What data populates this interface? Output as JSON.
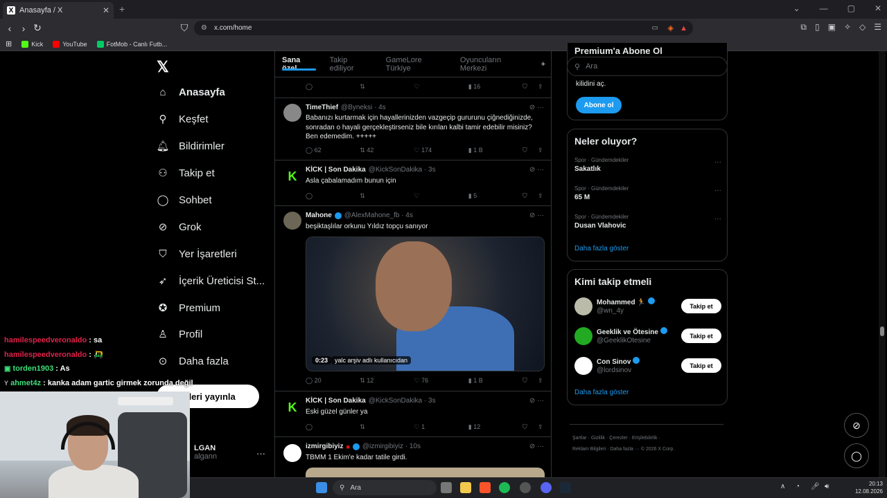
{
  "browser": {
    "tab_title": "Anasayfa / X",
    "url": "x.com/home",
    "bookmarks": [
      "Kick",
      "YouTube",
      "FotMob - Canlı Futb..."
    ]
  },
  "nav": {
    "items": [
      {
        "label": "Anasayfa",
        "icon": "home-icon"
      },
      {
        "label": "Keşfet",
        "icon": "search-icon"
      },
      {
        "label": "Bildirimler",
        "icon": "bell-icon"
      },
      {
        "label": "Takip et",
        "icon": "add-user-icon"
      },
      {
        "label": "Sohbet",
        "icon": "chat-icon"
      },
      {
        "label": "Grok",
        "icon": "grok-icon"
      },
      {
        "label": "Yer İşaretleri",
        "icon": "bookmark-icon"
      },
      {
        "label": "İçerik Üreticisi St...",
        "icon": "rocket-icon"
      },
      {
        "label": "Premium",
        "icon": "verified-icon"
      },
      {
        "label": "Profil",
        "icon": "user-icon"
      },
      {
        "label": "Daha fazla",
        "icon": "more-icon"
      }
    ],
    "post_button": "nderi yayınla",
    "account_name": "LGAN",
    "account_handle": "algann"
  },
  "feed_tabs": [
    "Sana özel",
    "Takip ediliyor",
    "GameLore Türkiye",
    "Oyuncuların Merkezi"
  ],
  "tweets": [
    {
      "views": "16"
    },
    {
      "name": "TimeThief",
      "handle": "@Byneksi · 4s",
      "text": "Babanızı kurtarmak için hayallerinizden vazgeçip gururunu çiğnediğinizde, sonradan o hayali gerçekleştirseniz bile kırılan kalbi tamir edebilir misiniz? Ben edemedim. +++++",
      "replies": "62",
      "retweets": "42",
      "likes": "174",
      "views": "1 B"
    },
    {
      "name": "KİCK | Son Dakika",
      "handle": "@KickSonDakika · 3s",
      "text": "Asla çabalamadım bunun için",
      "replies": "",
      "retweets": "",
      "likes": "",
      "views": "5"
    },
    {
      "name": "Mahone",
      "handle": "@AlexMahone_fb · 4s",
      "text": "beşiktaşlılar orkunu Yıldız topçu sanıyor",
      "video_time": "0:23",
      "video_credit": "yalc arşiv adlı kullanıcıdan",
      "replies": "20",
      "retweets": "12",
      "likes": "76",
      "views": "1 B"
    },
    {
      "name": "KİCK | Son Dakika",
      "handle": "@KickSonDakika · 3s",
      "text": "Eski güzel günler ya",
      "replies": "",
      "retweets": "",
      "likes": "1",
      "views": "12"
    },
    {
      "name": "izmirgibiyiz",
      "handle": "@izmirgibiyiz · 10s",
      "text": "TBMM 1 Ekim'e kadar tatile girdi."
    }
  ],
  "right": {
    "search_placeholder": "Ara",
    "premium_partial_title": "Premium'a Abone Ol",
    "premium_text": "kilidini aç.",
    "premium_button": "Abone ol",
    "trends_title": "Neler oluyor?",
    "trends": [
      {
        "category": "Spor · Gündemdekiler",
        "title": "Sakatlık"
      },
      {
        "category": "Spor · Gündemdekiler",
        "title": "65 M"
      },
      {
        "category": "Spor · Gündemdekiler",
        "title": "Dusan Vlahovic"
      }
    ],
    "show_more": "Daha fazla göster",
    "who_title": "Kimi takip etmeli",
    "who": [
      {
        "name": "Mohammed 🏃",
        "handle": "@wn_4y"
      },
      {
        "name": "Geeklik ve Ötesine",
        "handle": "@GeeklikOtesine"
      },
      {
        "name": "Con Sinov",
        "handle": "@lordsinov"
      }
    ],
    "follow_label": "Takip et",
    "footer_line1": "Şartlar  ·  Gizlilik  ·  Çerezler  ·  Erişilebilirlik  ·",
    "footer_line2": "Reklam Bilgileri  ·  Daha fazla ···  © 2026 X Corp."
  },
  "chat": [
    {
      "user": "hamilespeedveronaldo",
      "msg": ": sa",
      "color": "#e0204a"
    },
    {
      "user": "hamilespeedveronaldo",
      "msg": ": 🛺",
      "color": "#e0204a"
    },
    {
      "user": "torden1903",
      "msg": ": As",
      "color": "#3ee07a"
    },
    {
      "user": "ahmet4z",
      "msg": ": kanka adam gartic girmek zorunda değil",
      "color": "#3ee07a"
    }
  ],
  "taskbar": {
    "search": "Ara",
    "time": "20:13",
    "date": "12.08.2026"
  }
}
